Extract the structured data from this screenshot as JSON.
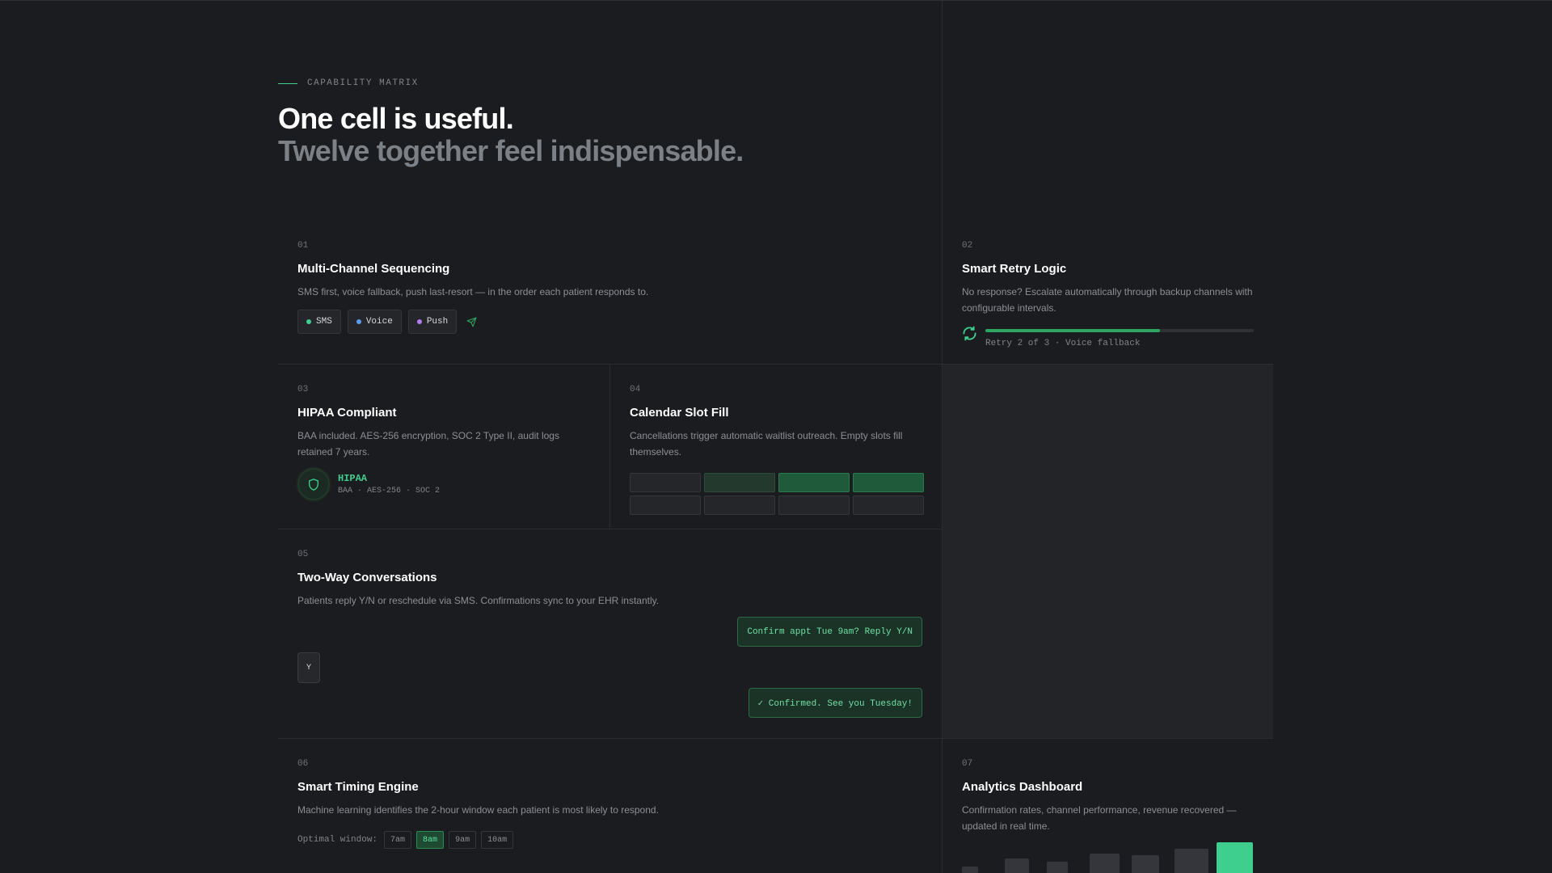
{
  "header": {
    "eyebrow": "CAPABILITY MATRIX",
    "title": "One cell is useful.",
    "subtitle": "Twelve together feel indispensable."
  },
  "cells": {
    "c01": {
      "num": "01",
      "title": "Multi-Channel Sequencing",
      "desc": "SMS first, voice fallback, push last-resort — in the order each patient responds to.",
      "channels": [
        {
          "label": "SMS",
          "color": "#3ecf8e"
        },
        {
          "label": "Voice",
          "color": "#5b9cf2"
        },
        {
          "label": "Push",
          "color": "#b57bf0"
        }
      ],
      "send_icon": "send-icon"
    },
    "c02": {
      "num": "02",
      "title": "Smart Retry Logic",
      "desc": "No response? Escalate automatically through backup channels with configurable intervals.",
      "retry_current": 2,
      "retry_total": 3,
      "progress_fraction": 0.65,
      "status": "Retry 2 of 3 · Voice fallback",
      "icon": "refresh-icon"
    },
    "c03": {
      "num": "03",
      "title": "HIPAA Compliant",
      "desc": "BAA included. AES-256 encryption, SOC 2 Type II, audit logs retained 7 years.",
      "badge_title": "HIPAA",
      "badge_sub": "BAA · AES-256 · SOC 2",
      "icon": "shield-icon"
    },
    "c04": {
      "num": "04",
      "title": "Calendar Slot Fill",
      "desc": "Cancellations trigger automatic waitlist outreach. Empty slots fill themselves.",
      "slots": [
        "empty",
        "pending",
        "filled",
        "filled",
        "empty",
        "empty",
        "empty",
        "empty"
      ]
    },
    "c05": {
      "num": "05",
      "title": "Two-Way Conversations",
      "desc": "Patients reply Y/N or reschedule via SMS. Confirmations sync to your EHR instantly.",
      "msg_out": "Confirm appt Tue 9am? Reply Y/N",
      "msg_in": "Y",
      "msg_confirm": "✓ Confirmed. See you Tuesday!"
    },
    "c06": {
      "num": "06",
      "title": "Smart Timing Engine",
      "desc": "Machine learning identifies the 2-hour window each patient is most likely to respond.",
      "window_label": "Optimal window:",
      "times": [
        {
          "label": "7am",
          "active": false
        },
        {
          "label": "8am",
          "active": true
        },
        {
          "label": "9am",
          "active": false
        },
        {
          "label": "10am",
          "active": false
        }
      ]
    },
    "c07": {
      "num": "07",
      "title": "Analytics Dashboard",
      "desc": "Confirmation rates, channel performance, revenue recovered — updated in real time.",
      "bars": [
        0.2,
        0.45,
        0.35,
        0.6,
        0.55,
        0.75,
        0.95
      ],
      "highlight_color": "#3ecf8e"
    }
  },
  "colors": {
    "accent": "#3ecf8e",
    "background": "#1b1c1f",
    "panel": "#232427"
  }
}
